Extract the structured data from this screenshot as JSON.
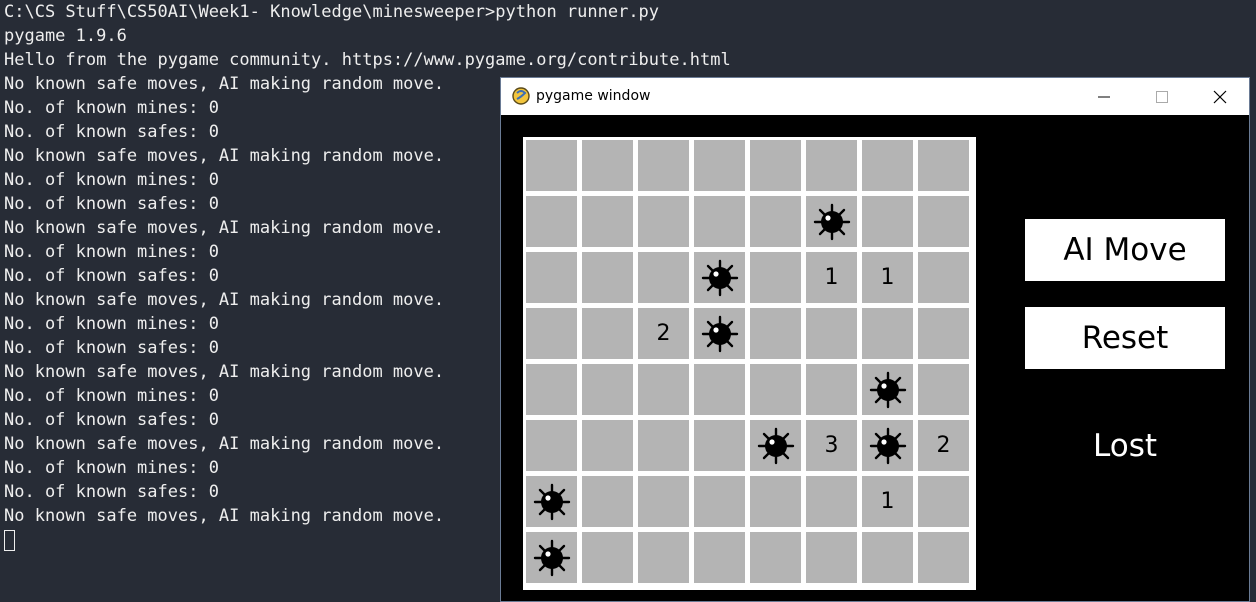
{
  "terminal": {
    "lines": [
      "C:\\CS Stuff\\CS50AI\\Week1- Knowledge\\minesweeper>python runner.py",
      "pygame 1.9.6",
      "Hello from the pygame community. https://www.pygame.org/contribute.html",
      "No known safe moves, AI making random move.",
      "No. of known mines: 0",
      "No. of known safes: 0",
      "No known safe moves, AI making random move.",
      "No. of known mines: 0",
      "No. of known safes: 0",
      "No known safe moves, AI making random move.",
      "No. of known mines: 0",
      "No. of known safes: 0",
      "No known safe moves, AI making random move.",
      "No. of known mines: 0",
      "No. of known safes: 0",
      "No known safe moves, AI making random move.",
      "No. of known mines: 0",
      "No. of known safes: 0",
      "No known safe moves, AI making random move.",
      "No. of known mines: 0",
      "No. of known safes: 0",
      "No known safe moves, AI making random move."
    ]
  },
  "window": {
    "title": "pygame window",
    "icon": "pygame-snake-icon",
    "controls": [
      "minimize-icon",
      "maximize-icon",
      "close-icon"
    ]
  },
  "board": {
    "rows": [
      [
        "",
        "",
        "",
        "",
        "",
        "",
        "",
        ""
      ],
      [
        "",
        "",
        "",
        "",
        "",
        "mine",
        "",
        ""
      ],
      [
        "",
        "",
        "",
        "mine",
        "",
        "1",
        "1",
        ""
      ],
      [
        "",
        "",
        "2",
        "mine",
        "",
        "",
        "",
        ""
      ],
      [
        "",
        "",
        "",
        "",
        "",
        "",
        "mine",
        ""
      ],
      [
        "",
        "",
        "",
        "",
        "mine",
        "3",
        "mine",
        "2"
      ],
      [
        "mine",
        "",
        "",
        "",
        "",
        "",
        "1",
        ""
      ],
      [
        "mine",
        "",
        "",
        "",
        "",
        "",
        "",
        ""
      ]
    ]
  },
  "controls": {
    "ai_move_label": "AI Move",
    "reset_label": "Reset",
    "status": "Lost"
  },
  "colors": {
    "terminal_bg": "#272c36",
    "cell": "#b4b4b4",
    "grid": "#ffffff",
    "window_bg": "#000000"
  }
}
